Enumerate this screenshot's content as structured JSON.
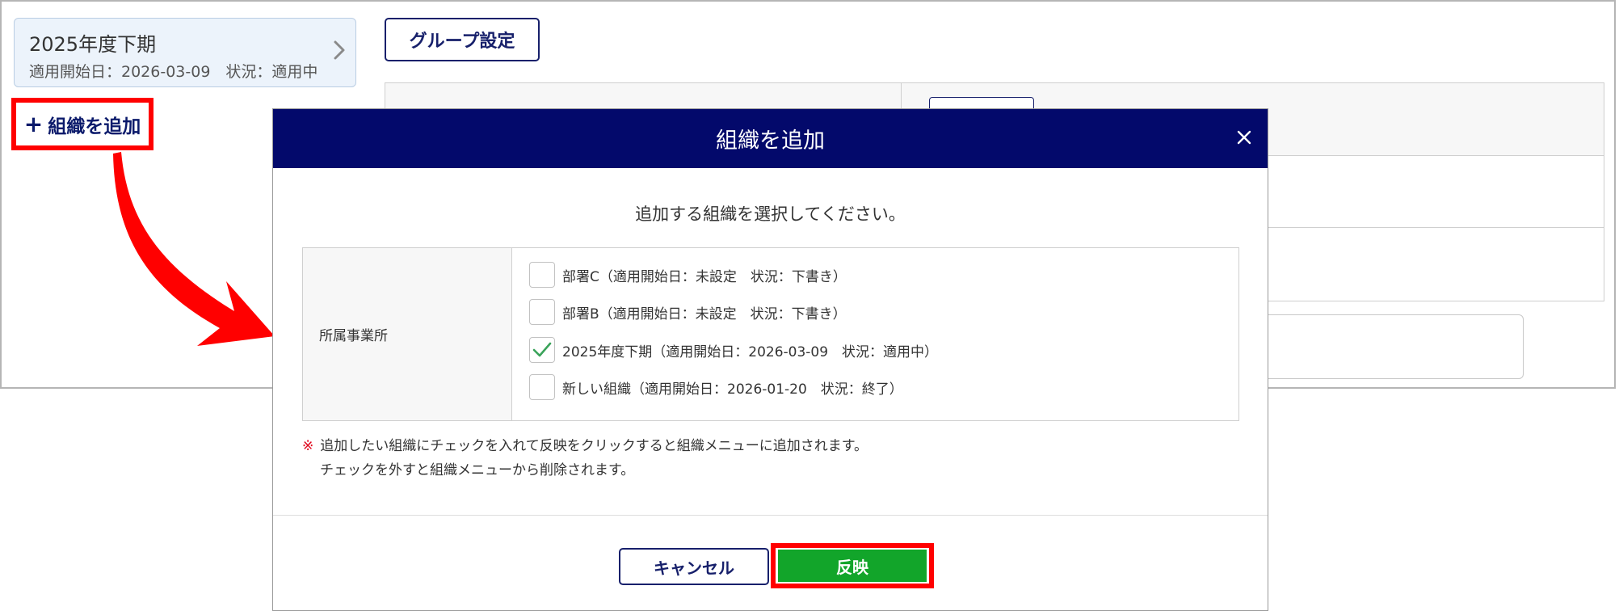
{
  "org_card": {
    "title": "2025年度下期",
    "subtitle": "適用開始日：2026-03-09　状況：適用中"
  },
  "add_org_link": {
    "label": "組織を追加",
    "plus": "+"
  },
  "group_settings_button": "グループ設定",
  "modal": {
    "title": "組織を追加",
    "description": "追加する組織を選択してください。",
    "field_label": "所属事業所",
    "options": [
      {
        "label": "部署C（適用開始日：未設定　状況：下書き）",
        "checked": false
      },
      {
        "label": "部署B（適用開始日：未設定　状況：下書き）",
        "checked": false
      },
      {
        "label": "2025年度下期（適用開始日：2026-03-09　状況：適用中）",
        "checked": true
      },
      {
        "label": "新しい組織（適用開始日：2026-01-20　状況：終了）",
        "checked": false
      }
    ],
    "note_mark": "※",
    "note_line1": "追加したい組織にチェックを入れて反映をクリックすると組織メニューに追加されます。",
    "note_line2": "チェックを外すと組織メニューから削除されます。",
    "cancel_label": "キャンセル",
    "apply_label": "反映"
  },
  "colors": {
    "modal_header": "#03096b",
    "apply_button": "#12a52a",
    "highlight": "#ff0000",
    "check": "#3aa35a"
  },
  "icons": {
    "close": "close-icon",
    "chevron": "chevron-right-icon",
    "check": "check-icon",
    "arrow": "annotation-arrow-icon"
  }
}
